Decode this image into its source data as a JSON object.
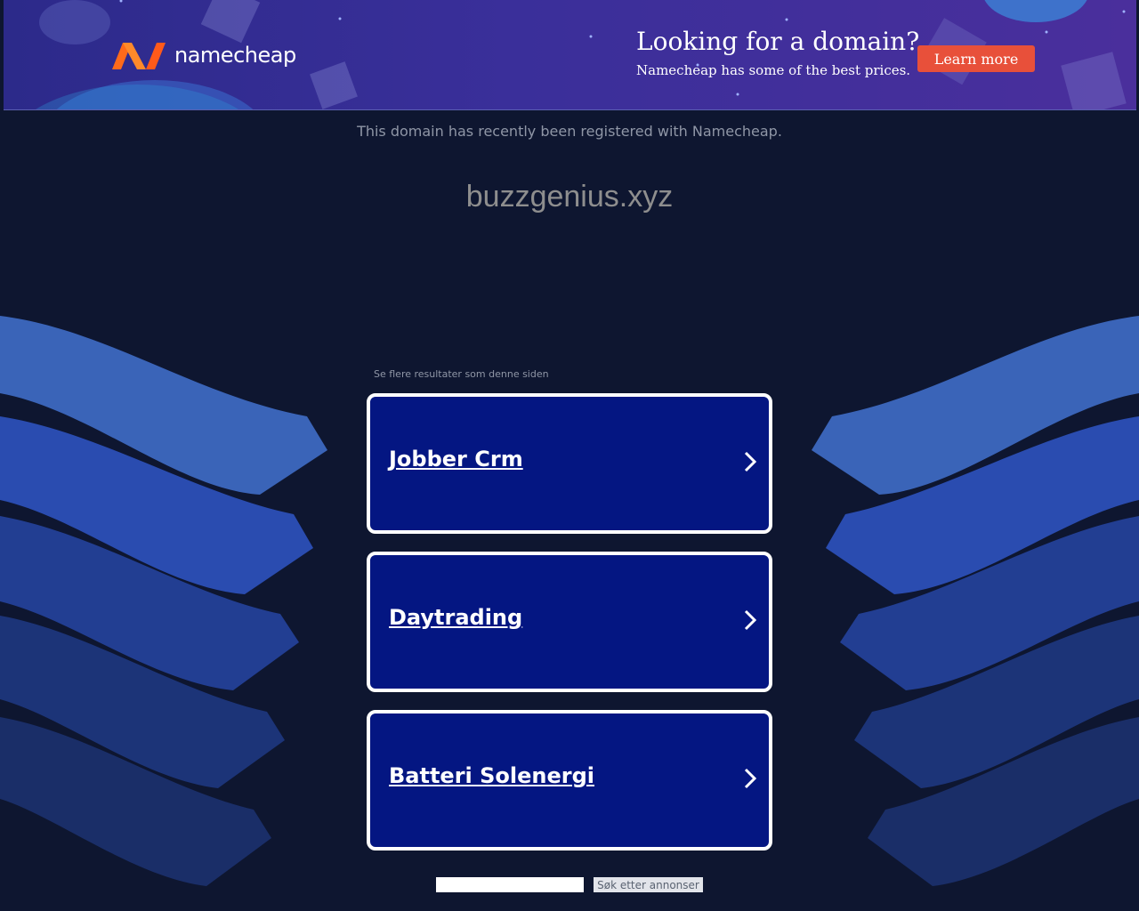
{
  "banner": {
    "logo_text": "namecheap",
    "title": "Looking for a domain?",
    "subtitle": "Namecheap has some of the best prices.",
    "cta_label": "Learn more"
  },
  "notice": "This domain has recently been registered with Namecheap.",
  "domain_name": "buzzgenius.xyz",
  "related_heading": "Se flere resultater som denne siden",
  "results": [
    {
      "label": "Jobber Crm"
    },
    {
      "label": "Daytrading"
    },
    {
      "label": "Batteri Solenergi"
    }
  ],
  "search": {
    "input_value": "",
    "button_label": "Søk etter annonser"
  },
  "colors": {
    "background": "#0e1630",
    "card": "#041682",
    "cta": "#e8503a",
    "logo_orange": "#ff6a1a"
  }
}
